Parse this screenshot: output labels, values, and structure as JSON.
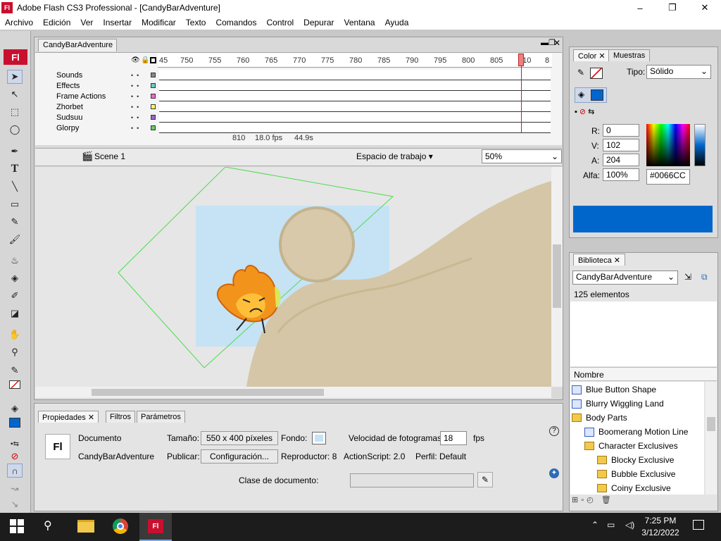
{
  "window": {
    "title": "Adobe Flash CS3 Professional - [CandyBarAdventure]",
    "logo": "Fl",
    "minimize": "–",
    "restore": "❐",
    "close": "✕"
  },
  "menu": [
    "Archivo",
    "Edición",
    "Ver",
    "Insertar",
    "Modificar",
    "Texto",
    "Comandos",
    "Control",
    "Depurar",
    "Ventana",
    "Ayuda"
  ],
  "tools_logo": "Fl",
  "document": {
    "tab": "CandyBarAdventure",
    "ruler_ticks": [
      "45",
      "750",
      "755",
      "760",
      "765",
      "770",
      "775",
      "780",
      "785",
      "790",
      "795",
      "800",
      "805",
      "810",
      "8"
    ],
    "layers": [
      {
        "name": "Sounds",
        "color": "#888888"
      },
      {
        "name": "Effects",
        "color": "#66cccc"
      },
      {
        "name": "Frame Actions",
        "color": "#ff66cc"
      },
      {
        "name": "Zhorbet",
        "color": "#ffff66"
      },
      {
        "name": "Sudsuu",
        "color": "#9966cc"
      },
      {
        "name": "Glorpy",
        "color": "#66cc66"
      }
    ],
    "current_frame": "810",
    "fps": "18.0 fps",
    "time": "44.9s",
    "scene": "Scene 1",
    "workspace": "Espacio de trabajo",
    "zoom": "50%"
  },
  "properties": {
    "tabs": [
      "Propiedades",
      "Filtros",
      "Parámetros"
    ],
    "type": "Documento",
    "doc_name": "CandyBarAdventure",
    "logo": "Fl",
    "size_label": "Tamaño:",
    "size_value": "550 x 400 píxeles",
    "bg_label": "Fondo:",
    "fps_label": "Velocidad de fotogramas:",
    "fps_value": "18",
    "fps_unit": "fps",
    "publish_label": "Publicar:",
    "publish_btn": "Configuración...",
    "player": "Reproductor: 8",
    "actionscript": "ActionScript: 2.0",
    "profile": "Perfil: Default",
    "class_label": "Clase de documento:",
    "class_value": ""
  },
  "color_panel": {
    "tabs": [
      "Color",
      "Muestras"
    ],
    "type_label": "Tipo:",
    "type_value": "Sólido",
    "r_label": "R:",
    "r": "0",
    "g_label": "V:",
    "g": "102",
    "b_label": "A:",
    "b": "204",
    "alpha_label": "Alfa:",
    "alpha": "100%",
    "hex": "#0066CC",
    "swatch": "#0066cc"
  },
  "library": {
    "tab": "Biblioteca",
    "document": "CandyBarAdventure",
    "count": "125 elementos",
    "column": "Nombre",
    "items": [
      {
        "name": "Blue Button Shape",
        "kind": "symbol",
        "indent": 0
      },
      {
        "name": "Blurry Wiggling Land",
        "kind": "symbol",
        "indent": 0
      },
      {
        "name": "Body Parts",
        "kind": "folder-open",
        "indent": 0
      },
      {
        "name": "Boomerang Motion Line",
        "kind": "symbol",
        "indent": 1
      },
      {
        "name": "Character Exclusives",
        "kind": "folder-open",
        "indent": 1
      },
      {
        "name": "Blocky Exclusive",
        "kind": "folder",
        "indent": 2
      },
      {
        "name": "Bubble Exclusive",
        "kind": "folder",
        "indent": 2
      },
      {
        "name": "Coiny Exclusive",
        "kind": "folder",
        "indent": 2
      }
    ]
  },
  "taskbar": {
    "time": "7:25 PM",
    "date": "3/12/2022",
    "app_logo": "Fl"
  }
}
